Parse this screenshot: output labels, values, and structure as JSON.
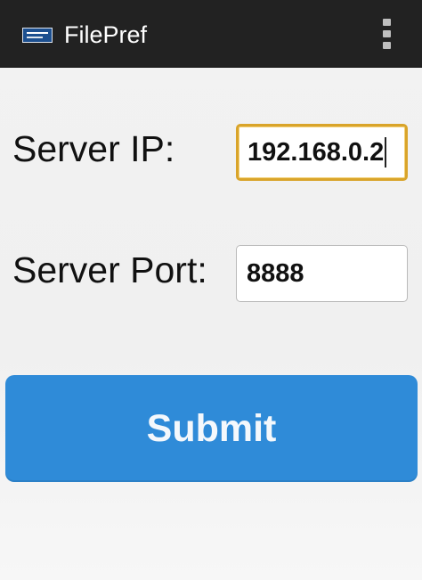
{
  "app_bar": {
    "title": "FilePref",
    "icon": "app-logo-icon",
    "menu_icon": "overflow-menu-icon",
    "background": "#222222"
  },
  "form": {
    "server_ip": {
      "label": "Server IP:",
      "value": "192.168.0.2",
      "focused": true
    },
    "server_port": {
      "label": "Server Port:",
      "value": "8888"
    },
    "submit": {
      "label": "Submit",
      "color": "#2f8bd8"
    }
  },
  "colors": {
    "focus_border": "#d9a42a",
    "accent": "#2f8bd8"
  }
}
